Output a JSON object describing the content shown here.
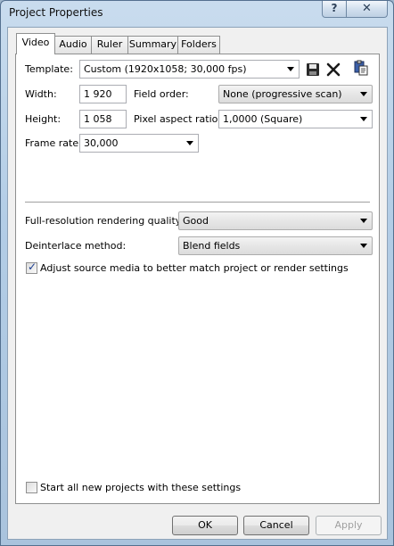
{
  "window": {
    "title": "Project Properties",
    "help_label": "?",
    "close_label": "✕"
  },
  "tabs": [
    {
      "label": "Video",
      "active": true
    },
    {
      "label": "Audio",
      "active": false
    },
    {
      "label": "Ruler",
      "active": false
    },
    {
      "label": "Summary",
      "active": false
    },
    {
      "label": "Folders",
      "active": false
    }
  ],
  "video": {
    "template_label": "Template:",
    "template_value": "Custom (1920x1058; 30,000 fps)",
    "width_label": "Width:",
    "width_value": "1 920",
    "height_label": "Height:",
    "height_value": "1 058",
    "field_order_label": "Field order:",
    "field_order_value": "None (progressive scan)",
    "pixel_aspect_label": "Pixel aspect ratio:",
    "pixel_aspect_value": "1,0000 (Square)",
    "frame_rate_label": "Frame rate:",
    "frame_rate_value": "30,000",
    "render_quality_label": "Full-resolution rendering quality:",
    "render_quality_value": "Good",
    "deinterlace_label": "Deinterlace method:",
    "deinterlace_value": "Blend fields",
    "adjust_label": "Adjust source media to better match project or render settings",
    "adjust_checked": true
  },
  "footer": {
    "start_all_label": "Start all new projects with these settings",
    "start_all_checked": false,
    "ok_label": "OK",
    "cancel_label": "Cancel",
    "apply_label": "Apply"
  },
  "icons": [
    "save-icon",
    "delete-icon",
    "paste-icon"
  ]
}
